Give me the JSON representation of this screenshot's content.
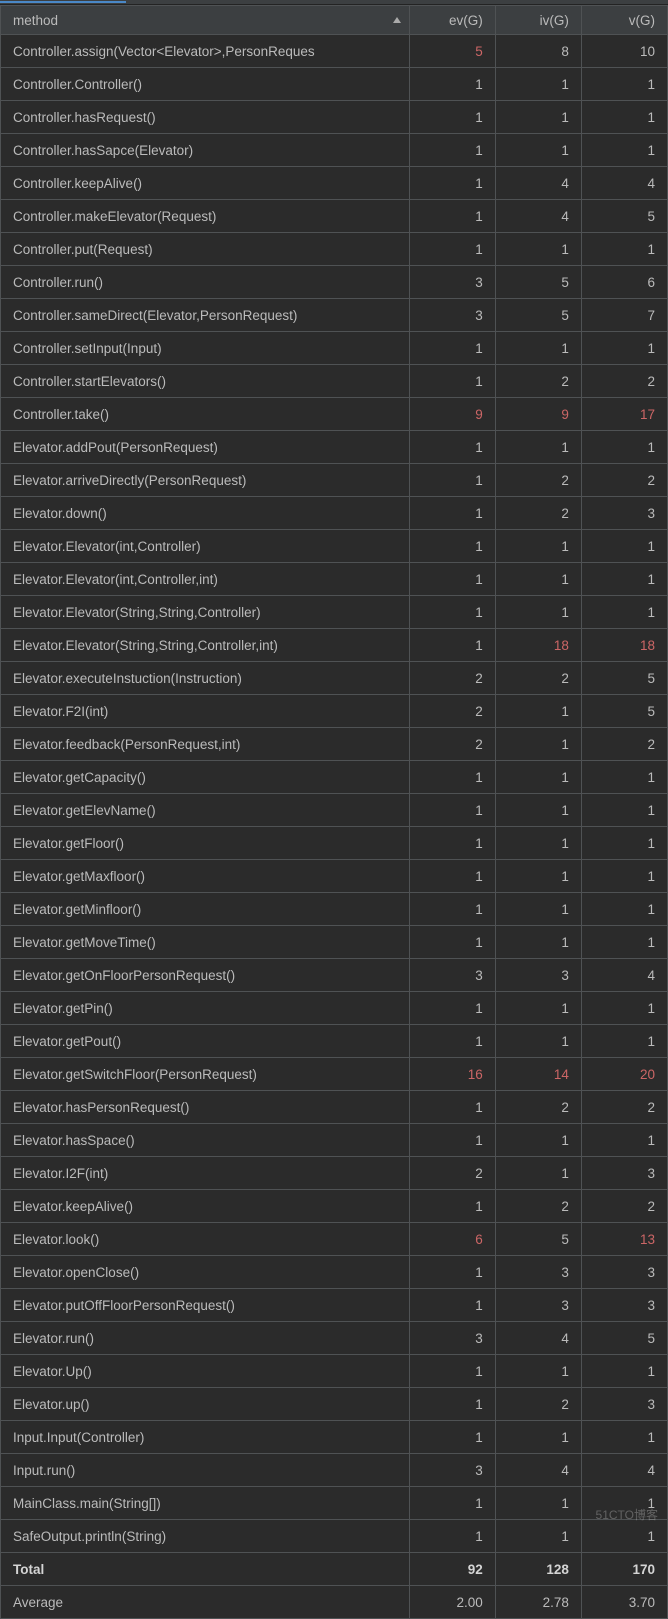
{
  "header": {
    "method": "method",
    "ev": "ev(G)",
    "iv": "iv(G)",
    "v": "v(G)"
  },
  "rows": [
    {
      "method": "Controller.assign(Vector<Elevator>,PersonReques",
      "ev": "5",
      "iv": "8",
      "v": "10",
      "ev_red": true
    },
    {
      "method": "Controller.Controller()",
      "ev": "1",
      "iv": "1",
      "v": "1"
    },
    {
      "method": "Controller.hasRequest()",
      "ev": "1",
      "iv": "1",
      "v": "1"
    },
    {
      "method": "Controller.hasSapce(Elevator)",
      "ev": "1",
      "iv": "1",
      "v": "1"
    },
    {
      "method": "Controller.keepAlive()",
      "ev": "1",
      "iv": "4",
      "v": "4"
    },
    {
      "method": "Controller.makeElevator(Request)",
      "ev": "1",
      "iv": "4",
      "v": "5"
    },
    {
      "method": "Controller.put(Request)",
      "ev": "1",
      "iv": "1",
      "v": "1"
    },
    {
      "method": "Controller.run()",
      "ev": "3",
      "iv": "5",
      "v": "6"
    },
    {
      "method": "Controller.sameDirect(Elevator,PersonRequest)",
      "ev": "3",
      "iv": "5",
      "v": "7"
    },
    {
      "method": "Controller.setInput(Input)",
      "ev": "1",
      "iv": "1",
      "v": "1"
    },
    {
      "method": "Controller.startElevators()",
      "ev": "1",
      "iv": "2",
      "v": "2"
    },
    {
      "method": "Controller.take()",
      "ev": "9",
      "iv": "9",
      "v": "17",
      "ev_red": true,
      "iv_red": true,
      "v_red": true
    },
    {
      "method": "Elevator.addPout(PersonRequest)",
      "ev": "1",
      "iv": "1",
      "v": "1"
    },
    {
      "method": "Elevator.arriveDirectly(PersonRequest)",
      "ev": "1",
      "iv": "2",
      "v": "2"
    },
    {
      "method": "Elevator.down()",
      "ev": "1",
      "iv": "2",
      "v": "3"
    },
    {
      "method": "Elevator.Elevator(int,Controller)",
      "ev": "1",
      "iv": "1",
      "v": "1"
    },
    {
      "method": "Elevator.Elevator(int,Controller,int)",
      "ev": "1",
      "iv": "1",
      "v": "1"
    },
    {
      "method": "Elevator.Elevator(String,String,Controller)",
      "ev": "1",
      "iv": "1",
      "v": "1"
    },
    {
      "method": "Elevator.Elevator(String,String,Controller,int)",
      "ev": "1",
      "iv": "18",
      "v": "18",
      "iv_red": true,
      "v_red": true
    },
    {
      "method": "Elevator.executeInstuction(Instruction)",
      "ev": "2",
      "iv": "2",
      "v": "5"
    },
    {
      "method": "Elevator.F2I(int)",
      "ev": "2",
      "iv": "1",
      "v": "5"
    },
    {
      "method": "Elevator.feedback(PersonRequest,int)",
      "ev": "2",
      "iv": "1",
      "v": "2"
    },
    {
      "method": "Elevator.getCapacity()",
      "ev": "1",
      "iv": "1",
      "v": "1"
    },
    {
      "method": "Elevator.getElevName()",
      "ev": "1",
      "iv": "1",
      "v": "1"
    },
    {
      "method": "Elevator.getFloor()",
      "ev": "1",
      "iv": "1",
      "v": "1"
    },
    {
      "method": "Elevator.getMaxfloor()",
      "ev": "1",
      "iv": "1",
      "v": "1"
    },
    {
      "method": "Elevator.getMinfloor()",
      "ev": "1",
      "iv": "1",
      "v": "1"
    },
    {
      "method": "Elevator.getMoveTime()",
      "ev": "1",
      "iv": "1",
      "v": "1"
    },
    {
      "method": "Elevator.getOnFloorPersonRequest()",
      "ev": "3",
      "iv": "3",
      "v": "4"
    },
    {
      "method": "Elevator.getPin()",
      "ev": "1",
      "iv": "1",
      "v": "1"
    },
    {
      "method": "Elevator.getPout()",
      "ev": "1",
      "iv": "1",
      "v": "1"
    },
    {
      "method": "Elevator.getSwitchFloor(PersonRequest)",
      "ev": "16",
      "iv": "14",
      "v": "20",
      "ev_red": true,
      "iv_red": true,
      "v_red": true
    },
    {
      "method": "Elevator.hasPersonRequest()",
      "ev": "1",
      "iv": "2",
      "v": "2"
    },
    {
      "method": "Elevator.hasSpace()",
      "ev": "1",
      "iv": "1",
      "v": "1"
    },
    {
      "method": "Elevator.I2F(int)",
      "ev": "2",
      "iv": "1",
      "v": "3"
    },
    {
      "method": "Elevator.keepAlive()",
      "ev": "1",
      "iv": "2",
      "v": "2"
    },
    {
      "method": "Elevator.look()",
      "ev": "6",
      "iv": "5",
      "v": "13",
      "ev_red": true,
      "v_red": true
    },
    {
      "method": "Elevator.openClose()",
      "ev": "1",
      "iv": "3",
      "v": "3"
    },
    {
      "method": "Elevator.putOffFloorPersonRequest()",
      "ev": "1",
      "iv": "3",
      "v": "3"
    },
    {
      "method": "Elevator.run()",
      "ev": "3",
      "iv": "4",
      "v": "5"
    },
    {
      "method": "Elevator.Up()",
      "ev": "1",
      "iv": "1",
      "v": "1"
    },
    {
      "method": "Elevator.up()",
      "ev": "1",
      "iv": "2",
      "v": "3"
    },
    {
      "method": "Input.Input(Controller)",
      "ev": "1",
      "iv": "1",
      "v": "1"
    },
    {
      "method": "Input.run()",
      "ev": "3",
      "iv": "4",
      "v": "4"
    },
    {
      "method": "MainClass.main(String[])",
      "ev": "1",
      "iv": "1",
      "v": "1"
    },
    {
      "method": "SafeOutput.println(String)",
      "ev": "1",
      "iv": "1",
      "v": "1"
    }
  ],
  "total": {
    "label": "Total",
    "ev": "92",
    "iv": "128",
    "v": "170"
  },
  "average": {
    "label": "Average",
    "ev": "2.00",
    "iv": "2.78",
    "v": "3.70"
  },
  "watermark": "51CTO博客"
}
